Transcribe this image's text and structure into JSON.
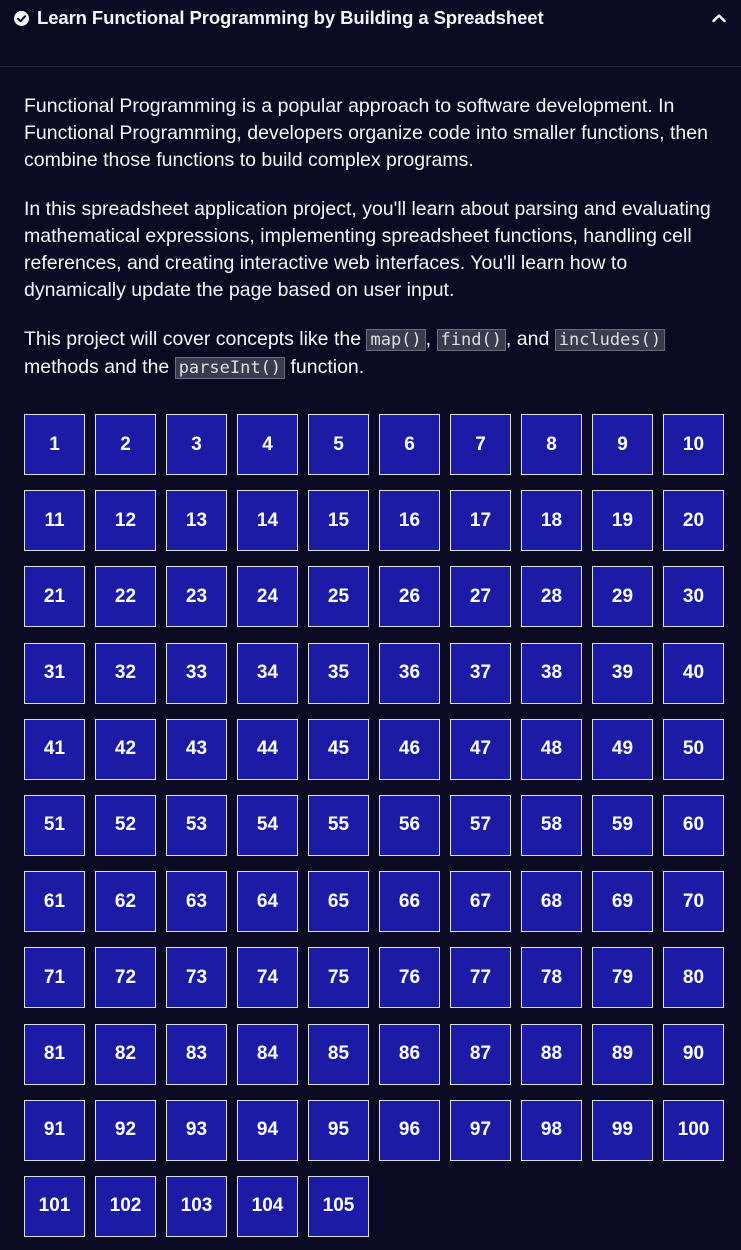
{
  "header": {
    "title": "Learn Functional Programming by Building a Spreadsheet",
    "check_icon": "check-circle-icon",
    "collapse_icon": "chevron-up-icon"
  },
  "description": {
    "p1": "Functional Programming is a popular approach to software development. In Functional Programming, developers organize code into smaller functions, then combine those functions to build complex programs.",
    "p2": "In this spreadsheet application project, you'll learn about parsing and evaluating mathematical expressions, implementing spreadsheet functions, handling cell references, and creating interactive web interfaces. You'll learn how to dynamically update the page based on user input.",
    "p3_prefix": "This project will cover concepts like the ",
    "code_map": "map()",
    "sep1": ", ",
    "code_find": "find()",
    "sep2": ", and ",
    "code_includes": "includes()",
    "p3_middle": " methods and the ",
    "code_parseint": "parseInt()",
    "p3_suffix": " function."
  },
  "steps": [
    "1",
    "2",
    "3",
    "4",
    "5",
    "6",
    "7",
    "8",
    "9",
    "10",
    "11",
    "12",
    "13",
    "14",
    "15",
    "16",
    "17",
    "18",
    "19",
    "20",
    "21",
    "22",
    "23",
    "24",
    "25",
    "26",
    "27",
    "28",
    "29",
    "30",
    "31",
    "32",
    "33",
    "34",
    "35",
    "36",
    "37",
    "38",
    "39",
    "40",
    "41",
    "42",
    "43",
    "44",
    "45",
    "46",
    "47",
    "48",
    "49",
    "50",
    "51",
    "52",
    "53",
    "54",
    "55",
    "56",
    "57",
    "58",
    "59",
    "60",
    "61",
    "62",
    "63",
    "64",
    "65",
    "66",
    "67",
    "68",
    "69",
    "70",
    "71",
    "72",
    "73",
    "74",
    "75",
    "76",
    "77",
    "78",
    "79",
    "80",
    "81",
    "82",
    "83",
    "84",
    "85",
    "86",
    "87",
    "88",
    "89",
    "90",
    "91",
    "92",
    "93",
    "94",
    "95",
    "96",
    "97",
    "98",
    "99",
    "100",
    "101",
    "102",
    "103",
    "104",
    "105"
  ],
  "colors": {
    "background": "#0a0a23",
    "step_background": "#1b1ba6",
    "step_border": "#dfdfe2",
    "text": "#f5f6f7"
  }
}
